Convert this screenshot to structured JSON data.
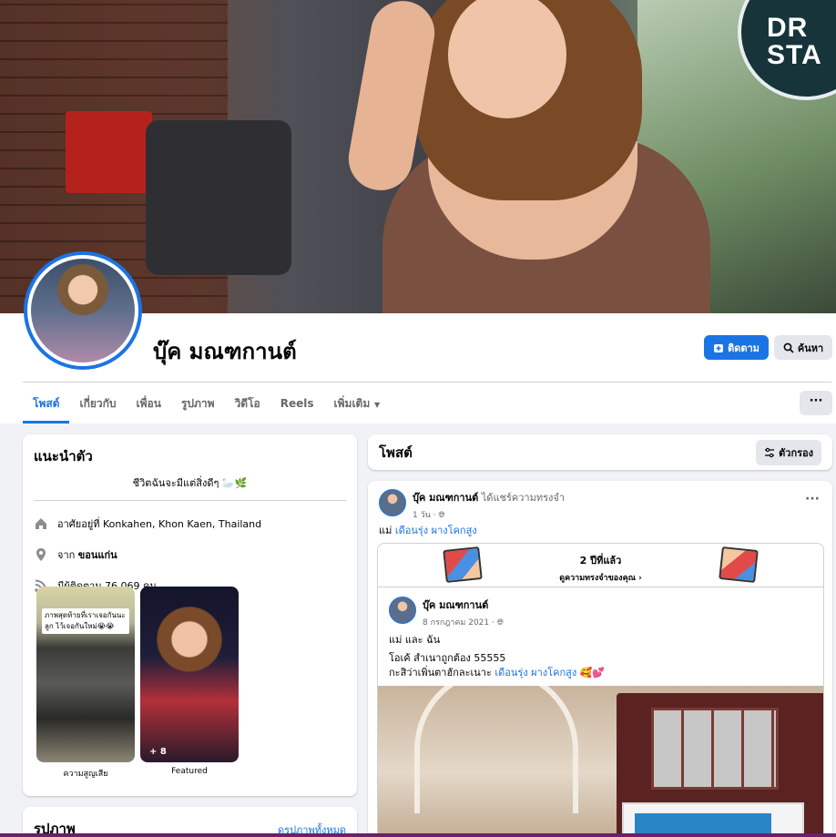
{
  "profile": {
    "name": "บุ๊ค มณฑกานต์",
    "follow_label": "ติดตาม",
    "search_label": "ค้นหา",
    "cover_sign": "DR\nSTA"
  },
  "tabs": [
    {
      "label": "โพสต์",
      "active": true
    },
    {
      "label": "เกี่ยวกับ"
    },
    {
      "label": "เพื่อน"
    },
    {
      "label": "รูปภาพ"
    },
    {
      "label": "วิดีโอ"
    },
    {
      "label": "Reels"
    },
    {
      "label": "เพิ่มเติม"
    }
  ],
  "more_label": "···",
  "intro": {
    "title": "แนะนำตัว",
    "bio": "ชีวิตฉันจะมีแต่สิ่งดีๆ 🦢🌿",
    "lives_prefix": "อาศัยอยู่ที่ ",
    "lives_value": "Konkahen, Khon Kaen, Thailand",
    "from_prefix": "จาก ",
    "from_value": "ขอนแก่น",
    "followers_text": "มีผู้ติดตาม 76,069 คน",
    "featured": [
      {
        "label": "ความสูญเสีย",
        "note": "ภาพสุดท้ายที่เราเจอกันนะลูก ไว้เจอกันใหม่😭😭"
      },
      {
        "label": "Featured",
        "count": "+ 8"
      }
    ]
  },
  "photos": {
    "title": "รูปภาพ",
    "link": "ดูรูปภาพทั้งหมด"
  },
  "posts_header": {
    "title": "โพสต์",
    "filter_label": "ตัวกรอง"
  },
  "post": {
    "author": "บุ๊ค มณฑกานต์",
    "action": " ได้แชร์ความทรงจำ",
    "time": "1 วัน ·",
    "caption_prefix": "แม่ ",
    "caption_tag": "เดือนรุ่ง ผางโคกสูง",
    "more": "···",
    "memory": {
      "years": "2 ปีที่แล้ว",
      "see": "ดูความทรงจำของคุณ ›"
    },
    "original": {
      "author": "บุ๊ค มณฑกานต์",
      "date": "8 กรกฎาคม 2021 ·",
      "line1": "แม่ และ ฉัน",
      "line2": "โอเค้ สำเนาถูกต้อง 55555",
      "line3_prefix": "กะสิว่าเพิ่นตาฮักละเนาะ ",
      "line3_tag": "เดือนรุ่ง ผางโคกสูง",
      "line3_suffix": " 🥰💕"
    }
  },
  "colors": {
    "accent": "#1b74e4",
    "background": "#f0f2f5",
    "secondary_text": "#65676b"
  }
}
